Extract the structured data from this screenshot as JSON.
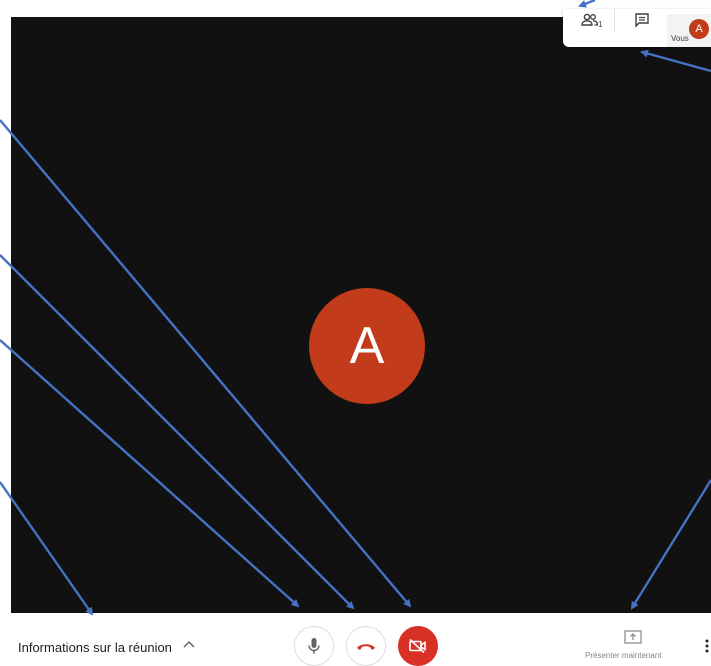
{
  "participant": {
    "initial": "A"
  },
  "top_bar": {
    "people_count": "1",
    "self_initial": "A",
    "self_label": "Vous"
  },
  "bottom_bar": {
    "meeting_info_label": "Informations sur la réunion",
    "present_label": "Présenter maintenant"
  },
  "icons": {
    "people": "people-icon",
    "chat": "chat-icon",
    "chevron": "chevron-up-icon",
    "mic": "mic-icon",
    "hangup": "hang-up-icon",
    "camera": "camera-off-icon",
    "present": "present-screen-icon",
    "more": "more-vert-icon"
  },
  "colors": {
    "avatar": "#c23b1b",
    "danger": "#d93025",
    "stage": "#111111",
    "annotation_arrow": "#4472c4"
  }
}
